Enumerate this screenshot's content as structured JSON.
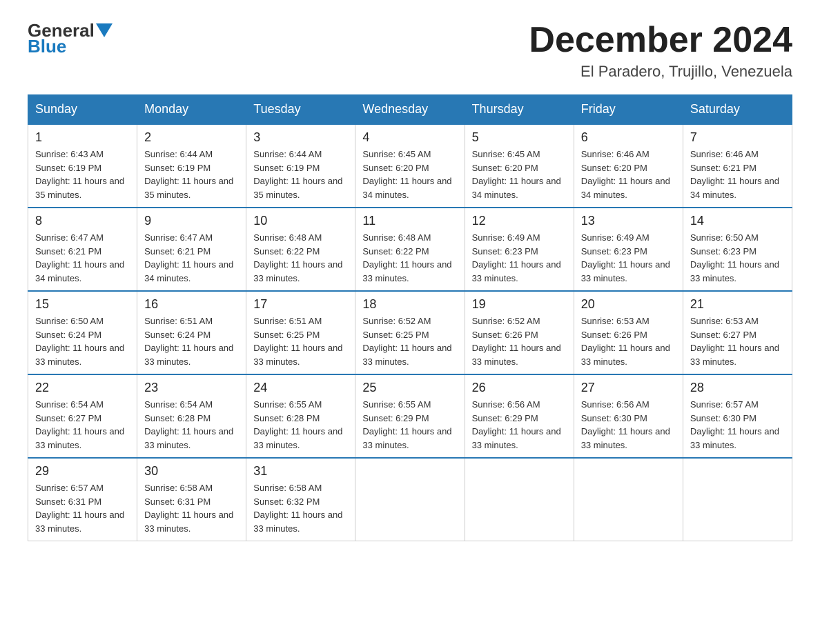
{
  "logo": {
    "text_general": "General",
    "text_blue": "Blue"
  },
  "header": {
    "month": "December 2024",
    "location": "El Paradero, Trujillo, Venezuela"
  },
  "weekdays": [
    "Sunday",
    "Monday",
    "Tuesday",
    "Wednesday",
    "Thursday",
    "Friday",
    "Saturday"
  ],
  "weeks": [
    [
      {
        "day": "1",
        "sunrise": "6:43 AM",
        "sunset": "6:19 PM",
        "daylight": "11 hours and 35 minutes."
      },
      {
        "day": "2",
        "sunrise": "6:44 AM",
        "sunset": "6:19 PM",
        "daylight": "11 hours and 35 minutes."
      },
      {
        "day": "3",
        "sunrise": "6:44 AM",
        "sunset": "6:19 PM",
        "daylight": "11 hours and 35 minutes."
      },
      {
        "day": "4",
        "sunrise": "6:45 AM",
        "sunset": "6:20 PM",
        "daylight": "11 hours and 34 minutes."
      },
      {
        "day": "5",
        "sunrise": "6:45 AM",
        "sunset": "6:20 PM",
        "daylight": "11 hours and 34 minutes."
      },
      {
        "day": "6",
        "sunrise": "6:46 AM",
        "sunset": "6:20 PM",
        "daylight": "11 hours and 34 minutes."
      },
      {
        "day": "7",
        "sunrise": "6:46 AM",
        "sunset": "6:21 PM",
        "daylight": "11 hours and 34 minutes."
      }
    ],
    [
      {
        "day": "8",
        "sunrise": "6:47 AM",
        "sunset": "6:21 PM",
        "daylight": "11 hours and 34 minutes."
      },
      {
        "day": "9",
        "sunrise": "6:47 AM",
        "sunset": "6:21 PM",
        "daylight": "11 hours and 34 minutes."
      },
      {
        "day": "10",
        "sunrise": "6:48 AM",
        "sunset": "6:22 PM",
        "daylight": "11 hours and 33 minutes."
      },
      {
        "day": "11",
        "sunrise": "6:48 AM",
        "sunset": "6:22 PM",
        "daylight": "11 hours and 33 minutes."
      },
      {
        "day": "12",
        "sunrise": "6:49 AM",
        "sunset": "6:23 PM",
        "daylight": "11 hours and 33 minutes."
      },
      {
        "day": "13",
        "sunrise": "6:49 AM",
        "sunset": "6:23 PM",
        "daylight": "11 hours and 33 minutes."
      },
      {
        "day": "14",
        "sunrise": "6:50 AM",
        "sunset": "6:23 PM",
        "daylight": "11 hours and 33 minutes."
      }
    ],
    [
      {
        "day": "15",
        "sunrise": "6:50 AM",
        "sunset": "6:24 PM",
        "daylight": "11 hours and 33 minutes."
      },
      {
        "day": "16",
        "sunrise": "6:51 AM",
        "sunset": "6:24 PM",
        "daylight": "11 hours and 33 minutes."
      },
      {
        "day": "17",
        "sunrise": "6:51 AM",
        "sunset": "6:25 PM",
        "daylight": "11 hours and 33 minutes."
      },
      {
        "day": "18",
        "sunrise": "6:52 AM",
        "sunset": "6:25 PM",
        "daylight": "11 hours and 33 minutes."
      },
      {
        "day": "19",
        "sunrise": "6:52 AM",
        "sunset": "6:26 PM",
        "daylight": "11 hours and 33 minutes."
      },
      {
        "day": "20",
        "sunrise": "6:53 AM",
        "sunset": "6:26 PM",
        "daylight": "11 hours and 33 minutes."
      },
      {
        "day": "21",
        "sunrise": "6:53 AM",
        "sunset": "6:27 PM",
        "daylight": "11 hours and 33 minutes."
      }
    ],
    [
      {
        "day": "22",
        "sunrise": "6:54 AM",
        "sunset": "6:27 PM",
        "daylight": "11 hours and 33 minutes."
      },
      {
        "day": "23",
        "sunrise": "6:54 AM",
        "sunset": "6:28 PM",
        "daylight": "11 hours and 33 minutes."
      },
      {
        "day": "24",
        "sunrise": "6:55 AM",
        "sunset": "6:28 PM",
        "daylight": "11 hours and 33 minutes."
      },
      {
        "day": "25",
        "sunrise": "6:55 AM",
        "sunset": "6:29 PM",
        "daylight": "11 hours and 33 minutes."
      },
      {
        "day": "26",
        "sunrise": "6:56 AM",
        "sunset": "6:29 PM",
        "daylight": "11 hours and 33 minutes."
      },
      {
        "day": "27",
        "sunrise": "6:56 AM",
        "sunset": "6:30 PM",
        "daylight": "11 hours and 33 minutes."
      },
      {
        "day": "28",
        "sunrise": "6:57 AM",
        "sunset": "6:30 PM",
        "daylight": "11 hours and 33 minutes."
      }
    ],
    [
      {
        "day": "29",
        "sunrise": "6:57 AM",
        "sunset": "6:31 PM",
        "daylight": "11 hours and 33 minutes."
      },
      {
        "day": "30",
        "sunrise": "6:58 AM",
        "sunset": "6:31 PM",
        "daylight": "11 hours and 33 minutes."
      },
      {
        "day": "31",
        "sunrise": "6:58 AM",
        "sunset": "6:32 PM",
        "daylight": "11 hours and 33 minutes."
      },
      null,
      null,
      null,
      null
    ]
  ]
}
